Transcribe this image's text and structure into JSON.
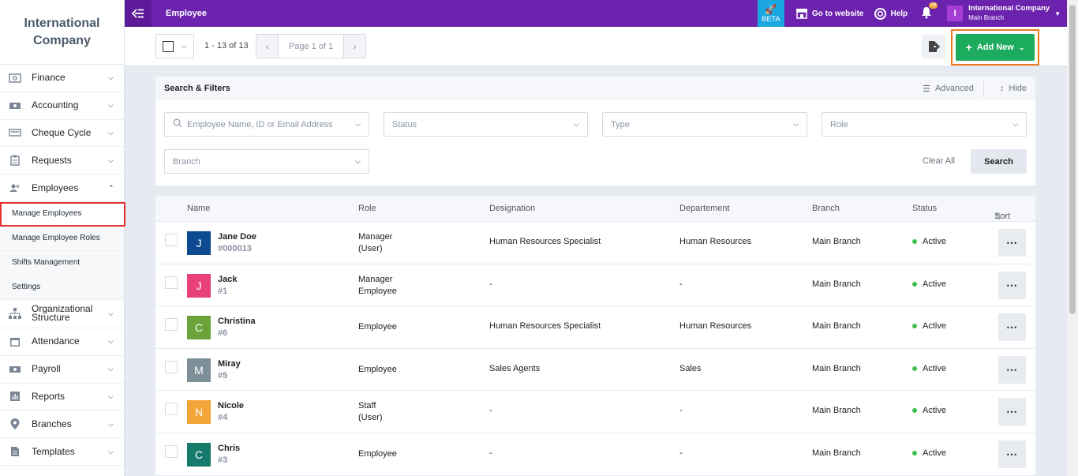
{
  "sidebar": {
    "brand": "International Company",
    "items": [
      {
        "label": "Finance",
        "icon": "money-icon"
      },
      {
        "label": "Accounting",
        "icon": "cash-icon"
      },
      {
        "label": "Cheque Cycle",
        "icon": "cheque-icon"
      },
      {
        "label": "Requests",
        "icon": "clipboard-icon"
      },
      {
        "label": "Employees",
        "icon": "users-icon"
      }
    ],
    "employees_sub": [
      "Manage Employees",
      "Manage Employee Roles",
      "Shifts Management",
      "Settings"
    ],
    "items_after": [
      {
        "label": "Organizational Structure",
        "icon": "org-icon"
      },
      {
        "label": "Attendance",
        "icon": "calendar-icon"
      },
      {
        "label": "Payroll",
        "icon": "payroll-icon"
      },
      {
        "label": "Reports",
        "icon": "chart-icon"
      },
      {
        "label": "Branches",
        "icon": "location-icon"
      },
      {
        "label": "Templates",
        "icon": "document-icon"
      }
    ]
  },
  "topbar": {
    "title": "Employee",
    "beta": "BETA",
    "go_to_website": "Go to website",
    "help": "Help",
    "notif_count": "99",
    "company_initial": "I",
    "company_name": "International Company",
    "company_branch": "Main Branch"
  },
  "toolbar": {
    "record_count": "1 - 13 of 13",
    "page_label": "Page 1 of 1",
    "add_new": "Add New"
  },
  "filters": {
    "title": "Search & Filters",
    "advanced": "Advanced",
    "hide": "Hide",
    "search_placeholder": "Employee Name, ID or Email Address",
    "status": "Status",
    "type": "Type",
    "role": "Role",
    "branch": "Branch",
    "clear_all": "Clear All",
    "search": "Search"
  },
  "table": {
    "headers": {
      "name": "Name",
      "role": "Role",
      "designation": "Designation",
      "department": "Departement",
      "branch": "Branch",
      "status": "Status",
      "sort": "Sort"
    },
    "rows": [
      {
        "initial": "J",
        "color": "#0d4a8f",
        "name": "Jane Doe",
        "id": "#000013",
        "role1": "Manager",
        "role2": "(User)",
        "designation": "Human Resources Specialist",
        "department": "Human Resources",
        "branch": "Main Branch",
        "status": "Active"
      },
      {
        "initial": "J",
        "color": "#e8407a",
        "name": "Jack",
        "id": "#1",
        "role1": "Manager",
        "role2": "Employee",
        "designation": "-",
        "department": "-",
        "branch": "Main Branch",
        "status": "Active"
      },
      {
        "initial": "C",
        "color": "#6ba33a",
        "name": "Christina",
        "id": "#6",
        "role1": "Employee",
        "role2": "",
        "designation": "Human Resources Specialist",
        "department": "Human Resources",
        "branch": "Main Branch",
        "status": "Active"
      },
      {
        "initial": "M",
        "color": "#7d8f99",
        "name": "Miray",
        "id": "#5",
        "role1": "Employee",
        "role2": "",
        "designation": "Sales Agents",
        "department": "Sales",
        "branch": "Main Branch",
        "status": "Active"
      },
      {
        "initial": "N",
        "color": "#f4a53a",
        "name": "Nicole",
        "id": "#4",
        "role1": "Staff",
        "role2": "(User)",
        "designation": "-",
        "department": "-",
        "branch": "Main Branch",
        "status": "Active"
      },
      {
        "initial": "C",
        "color": "#157a6b",
        "name": "Chris",
        "id": "#3",
        "role1": "Employee",
        "role2": "",
        "designation": "-",
        "department": "-",
        "branch": "Main Branch",
        "status": "Active"
      }
    ]
  }
}
